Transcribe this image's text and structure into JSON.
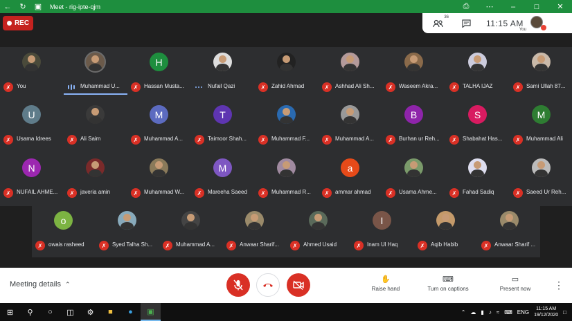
{
  "window": {
    "title": "Meet - rig-ipte-qjm"
  },
  "rec_label": "REC",
  "info": {
    "participant_count": "36",
    "time": "11:15 AM",
    "self_label": "You"
  },
  "rows": [
    [
      {
        "name": "You",
        "type": "photo",
        "bg": "#4a4a3a",
        "mic": "muted"
      },
      {
        "name": "Muhammad U...",
        "type": "photo",
        "bg": "#6b5a4a",
        "mic": "speaking",
        "ring": true,
        "active": true
      },
      {
        "name": "Hassan Musta...",
        "type": "letter",
        "letter": "H",
        "bg": "#1e8e3e",
        "mic": "muted"
      },
      {
        "name": "Nufail Qazi",
        "type": "photo",
        "bg": "#ddd",
        "mic": "dots"
      },
      {
        "name": "Zahid Ahmad",
        "type": "photo",
        "bg": "#222",
        "mic": "muted"
      },
      {
        "name": "Ashhad Ali Sh...",
        "type": "photo",
        "bg": "#b49a9a",
        "mic": "muted"
      },
      {
        "name": "Waseem Akra...",
        "type": "photo",
        "bg": "#8a6a4a",
        "mic": "muted"
      },
      {
        "name": "TALHA IJAZ",
        "type": "photo",
        "bg": "#ccd",
        "mic": "muted"
      },
      {
        "name": "Sami Ullah 87...",
        "type": "photo",
        "bg": "#c9b9a9",
        "mic": "muted"
      }
    ],
    [
      {
        "name": "Usama Idrees",
        "type": "letter",
        "letter": "U",
        "bg": "#5f7c8a",
        "mic": "muted"
      },
      {
        "name": "Ali Saim",
        "type": "photo",
        "bg": "#3a3a3a",
        "mic": "muted"
      },
      {
        "name": "Muhammad A...",
        "type": "letter",
        "letter": "M",
        "bg": "#5c6bc0",
        "mic": "muted"
      },
      {
        "name": "Taimoor Shah...",
        "type": "letter",
        "letter": "T",
        "bg": "#5e35b1",
        "mic": "muted"
      },
      {
        "name": "Muhammad F...",
        "type": "photo",
        "bg": "#2a6ab0",
        "mic": "muted"
      },
      {
        "name": "Muhammad A...",
        "type": "photo",
        "bg": "#999",
        "mic": "muted"
      },
      {
        "name": "Burhan ur Reh...",
        "type": "letter",
        "letter": "B",
        "bg": "#8e24aa",
        "mic": "muted"
      },
      {
        "name": "Shabahat Has...",
        "type": "letter",
        "letter": "S",
        "bg": "#d81b60",
        "mic": "muted"
      },
      {
        "name": "Muhammad Ali",
        "type": "letter",
        "letter": "M",
        "bg": "#2e7d32",
        "mic": "muted"
      }
    ],
    [
      {
        "name": "NUFAIL AHME...",
        "type": "letter",
        "letter": "N",
        "bg": "#9c27b0",
        "mic": "muted"
      },
      {
        "name": "javeria amin",
        "type": "photo",
        "bg": "#7a2a2a",
        "mic": "muted"
      },
      {
        "name": "Muhammad W...",
        "type": "photo",
        "bg": "#8a7a5a",
        "mic": "muted"
      },
      {
        "name": "Mareeha Saeed",
        "type": "letter",
        "letter": "M",
        "bg": "#7e57c2",
        "mic": "muted"
      },
      {
        "name": "Muhammad R...",
        "type": "photo",
        "bg": "#a08aa0",
        "mic": "muted"
      },
      {
        "name": "ammar ahmad",
        "type": "letter",
        "letter": "a",
        "bg": "#e64a19",
        "mic": "muted"
      },
      {
        "name": "Usama Ahme...",
        "type": "photo",
        "bg": "#7a9a6a",
        "mic": "muted"
      },
      {
        "name": "Fahad Sadiq",
        "type": "photo",
        "bg": "#dde",
        "mic": "muted"
      },
      {
        "name": "Saeed Ur Reh...",
        "type": "photo",
        "bg": "#bbb",
        "mic": "muted"
      }
    ],
    [
      {
        "name": "owais rasheed",
        "type": "letter",
        "letter": "o",
        "bg": "#7cb342",
        "mic": "muted"
      },
      {
        "name": "Syed Talha Sh...",
        "type": "photo",
        "bg": "#8ab",
        "mic": "muted"
      },
      {
        "name": "Muhammad A...",
        "type": "photo",
        "bg": "#444",
        "mic": "muted"
      },
      {
        "name": "Anwaar Sharif...",
        "type": "photo",
        "bg": "#9a8a6a",
        "mic": "muted"
      },
      {
        "name": "Ahmed Usaid",
        "type": "photo",
        "bg": "#5a6a5a",
        "mic": "muted"
      },
      {
        "name": "Inam Ul Haq",
        "type": "letter",
        "letter": "I",
        "bg": "#795548",
        "mic": "muted"
      },
      {
        "name": "Aqib Habib",
        "type": "photo",
        "bg": "#c49a6a",
        "mic": "muted"
      },
      {
        "name": "Anwaar Sharif ...",
        "type": "photo",
        "bg": "#9a8a6a",
        "mic": "muted"
      }
    ]
  ],
  "controls": {
    "meeting_details": "Meeting details",
    "raise_hand": "Raise hand",
    "captions": "Turn on captions",
    "present": "Present now"
  },
  "taskbar": {
    "lang": "ENG",
    "time": "11:15 AM",
    "date": "19/12/2020"
  },
  "colors": {
    "accent": "#1e8e3e",
    "danger": "#d93025",
    "speaking": "#8ab4f8"
  }
}
